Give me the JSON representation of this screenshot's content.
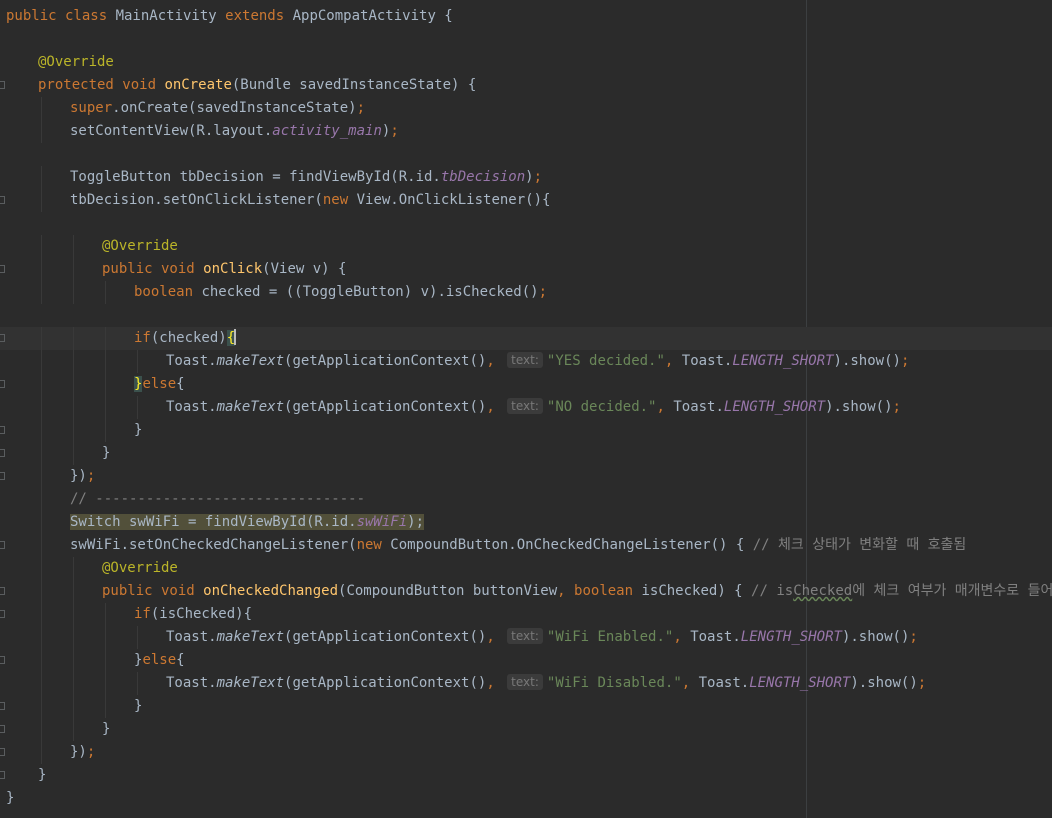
{
  "editor": {
    "language": "java",
    "hint_label": "text:",
    "lines": [
      {
        "indent": 0,
        "fold": false,
        "tokens": [
          [
            "kw",
            "public class "
          ],
          [
            "",
            "MainActivity "
          ],
          [
            "kw",
            "extends "
          ],
          [
            "",
            "AppCompatActivity {"
          ]
        ]
      },
      {
        "indent": 0,
        "fold": false,
        "tokens": []
      },
      {
        "indent": 1,
        "fold": false,
        "tokens": [
          [
            "ann",
            "@Override"
          ]
        ]
      },
      {
        "indent": 1,
        "fold": true,
        "tokens": [
          [
            "kw",
            "protected void "
          ],
          [
            "fn",
            "onCreate"
          ],
          [
            "",
            "(Bundle savedInstanceState) {"
          ]
        ]
      },
      {
        "indent": 2,
        "fold": false,
        "tokens": [
          [
            "kw",
            "super"
          ],
          [
            "",
            ".onCreate(savedInstanceState)"
          ],
          [
            "kw",
            ";"
          ]
        ]
      },
      {
        "indent": 2,
        "fold": false,
        "tokens": [
          [
            "",
            "setContentView(R.layout."
          ],
          [
            "fld",
            "activity_main"
          ],
          [
            "",
            ")"
          ],
          [
            "kw",
            ";"
          ]
        ]
      },
      {
        "indent": 0,
        "fold": false,
        "tokens": []
      },
      {
        "indent": 2,
        "fold": false,
        "tokens": [
          [
            "",
            "ToggleButton tbDecision = findViewById(R.id."
          ],
          [
            "fld",
            "tbDecision"
          ],
          [
            "",
            ")"
          ],
          [
            "kw",
            ";"
          ]
        ]
      },
      {
        "indent": 2,
        "fold": true,
        "tokens": [
          [
            "",
            "tbDecision.setOnClickListener("
          ],
          [
            "kw",
            "new "
          ],
          [
            "",
            "View.OnClickListener(){"
          ]
        ]
      },
      {
        "indent": 0,
        "fold": false,
        "tokens": []
      },
      {
        "indent": 3,
        "fold": false,
        "tokens": [
          [
            "ann",
            "@Override"
          ]
        ]
      },
      {
        "indent": 3,
        "fold": true,
        "tokens": [
          [
            "kw",
            "public void "
          ],
          [
            "fn",
            "onClick"
          ],
          [
            "",
            "(View v) {"
          ]
        ]
      },
      {
        "indent": 4,
        "fold": false,
        "tokens": [
          [
            "kw",
            "boolean "
          ],
          [
            "",
            "checked = ((ToggleButton) v).isChecked()"
          ],
          [
            "kw",
            ";"
          ]
        ]
      },
      {
        "indent": 0,
        "fold": false,
        "tokens": []
      },
      {
        "indent": 4,
        "fold": true,
        "caret": true,
        "tokens": [
          [
            "kw",
            "if"
          ],
          [
            "",
            "(checked)"
          ],
          [
            "brace",
            "{"
          ]
        ]
      },
      {
        "indent": 5,
        "fold": false,
        "tokens": [
          [
            "",
            "Toast."
          ],
          [
            "st",
            "makeText"
          ],
          [
            "",
            "(getApplicationContext()"
          ],
          [
            "kw",
            ", "
          ],
          [
            "hint",
            "text:"
          ],
          [
            "str",
            "\"YES decided.\""
          ],
          [
            "kw",
            ", "
          ],
          [
            "",
            "Toast."
          ],
          [
            "fld",
            "LENGTH_SHORT"
          ],
          [
            "",
            ").show()"
          ],
          [
            "kw",
            ";"
          ]
        ]
      },
      {
        "indent": 4,
        "fold": true,
        "tokens": [
          [
            "brace",
            "}"
          ],
          [
            "kw",
            "else"
          ],
          [
            "",
            "{"
          ]
        ]
      },
      {
        "indent": 5,
        "fold": false,
        "tokens": [
          [
            "",
            "Toast."
          ],
          [
            "st",
            "makeText"
          ],
          [
            "",
            "(getApplicationContext()"
          ],
          [
            "kw",
            ", "
          ],
          [
            "hint",
            "text:"
          ],
          [
            "str",
            "\"NO decided.\""
          ],
          [
            "kw",
            ", "
          ],
          [
            "",
            "Toast."
          ],
          [
            "fld",
            "LENGTH_SHORT"
          ],
          [
            "",
            ").show()"
          ],
          [
            "kw",
            ";"
          ]
        ]
      },
      {
        "indent": 4,
        "fold": true,
        "tokens": [
          [
            "",
            "}"
          ]
        ]
      },
      {
        "indent": 3,
        "fold": true,
        "tokens": [
          [
            "",
            "}"
          ]
        ]
      },
      {
        "indent": 2,
        "fold": true,
        "tokens": [
          [
            "",
            "})"
          ],
          [
            "kw",
            ";"
          ]
        ]
      },
      {
        "indent": 2,
        "fold": false,
        "tokens": [
          [
            "cmt",
            "// --------------------------------"
          ]
        ]
      },
      {
        "indent": 2,
        "fold": false,
        "tokens": [
          [
            "yl",
            "Switch swWiFi = findViewById(R.id."
          ],
          [
            "ylf",
            "swWiFi"
          ],
          [
            "yl",
            ");"
          ]
        ]
      },
      {
        "indent": 2,
        "fold": true,
        "tokens": [
          [
            "",
            "swWiFi.setOnCheckedChangeListener("
          ],
          [
            "kw",
            "new "
          ],
          [
            "",
            "CompoundButton.OnCheckedChangeListener() { "
          ],
          [
            "cmt",
            "// 체크 상태가 변화할 때 호출됨"
          ]
        ]
      },
      {
        "indent": 3,
        "fold": false,
        "tokens": [
          [
            "ann",
            "@Override"
          ]
        ]
      },
      {
        "indent": 3,
        "fold": true,
        "tokens": [
          [
            "kw",
            "public void "
          ],
          [
            "fn",
            "onCheckedChanged"
          ],
          [
            "",
            "(CompoundButton buttonView"
          ],
          [
            "kw",
            ", boolean "
          ],
          [
            "",
            "isChecked) { "
          ],
          [
            "cmt",
            "// is"
          ],
          [
            "cmtw",
            "Checked"
          ],
          [
            "cmt",
            "에 체크 여부가 매개변수로 들어옴"
          ]
        ]
      },
      {
        "indent": 4,
        "fold": true,
        "tokens": [
          [
            "kw",
            "if"
          ],
          [
            "",
            "(isChecked){"
          ]
        ]
      },
      {
        "indent": 5,
        "fold": false,
        "tokens": [
          [
            "",
            "Toast."
          ],
          [
            "st",
            "makeText"
          ],
          [
            "",
            "(getApplicationContext()"
          ],
          [
            "kw",
            ", "
          ],
          [
            "hint",
            "text:"
          ],
          [
            "str",
            "\"WiFi Enabled.\""
          ],
          [
            "kw",
            ", "
          ],
          [
            "",
            "Toast."
          ],
          [
            "fld",
            "LENGTH_SHORT"
          ],
          [
            "",
            ").show()"
          ],
          [
            "kw",
            ";"
          ]
        ]
      },
      {
        "indent": 4,
        "fold": true,
        "tokens": [
          [
            "",
            "}"
          ],
          [
            "kw",
            "else"
          ],
          [
            "",
            "{"
          ]
        ]
      },
      {
        "indent": 5,
        "fold": false,
        "tokens": [
          [
            "",
            "Toast."
          ],
          [
            "st",
            "makeText"
          ],
          [
            "",
            "(getApplicationContext()"
          ],
          [
            "kw",
            ", "
          ],
          [
            "hint",
            "text:"
          ],
          [
            "str",
            "\"WiFi Disabled.\""
          ],
          [
            "kw",
            ", "
          ],
          [
            "",
            "Toast."
          ],
          [
            "fld",
            "LENGTH_SHORT"
          ],
          [
            "",
            ").show()"
          ],
          [
            "kw",
            ";"
          ]
        ]
      },
      {
        "indent": 4,
        "fold": true,
        "tokens": [
          [
            "",
            "}"
          ]
        ]
      },
      {
        "indent": 3,
        "fold": true,
        "tokens": [
          [
            "",
            "}"
          ]
        ]
      },
      {
        "indent": 2,
        "fold": true,
        "tokens": [
          [
            "",
            "})"
          ],
          [
            "kw",
            ";"
          ]
        ]
      },
      {
        "indent": 1,
        "fold": true,
        "tokens": [
          [
            "",
            "}"
          ]
        ]
      },
      {
        "indent": 0,
        "fold": false,
        "tokens": [
          [
            "",
            "}"
          ]
        ]
      }
    ]
  },
  "colors": {
    "background": "#2b2b2b",
    "keyword": "#cc7832",
    "method_decl": "#ffc66d",
    "annotation": "#bbb529",
    "string": "#6a8759",
    "field": "#9876aa",
    "comment": "#808080",
    "plain": "#a9b7c6"
  }
}
